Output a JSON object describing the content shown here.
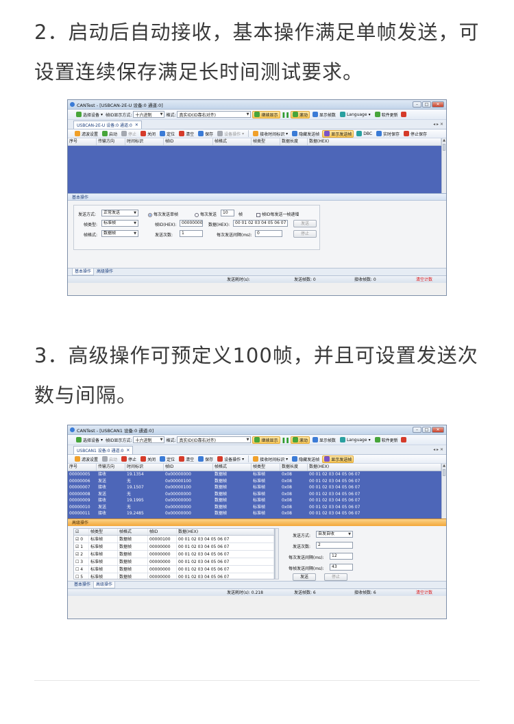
{
  "captions": {
    "cap1": "2．启动后自动接收，基本操作满足单帧发送，可设置连续保存满足长时间测试要求。",
    "cap2": "3．高级操作可预定义100帧，并且可设置发送次数与间隔。"
  },
  "win1": {
    "title": "CANTest - [USBCAN-2E-U 设备:0 通道:0]",
    "tab": "USBCAN-2E-U 设备:0 通道:0",
    "toolbar2": [
      "滤波设置",
      "启动",
      "停止",
      "关闭",
      "定位",
      "清空",
      "保存",
      "设备操作",
      "接收时间标识",
      "隐藏发送帧",
      "显示发送帧",
      "DBC",
      "实时保存",
      "停止保存"
    ],
    "panel_title": "基本操作",
    "form": {
      "send_mode_label": "发送方式:",
      "send_mode_value": "正常发送",
      "frame_type_label": "帧类型:",
      "frame_type_value": "标准帧",
      "frame_format_label": "帧格式:",
      "frame_format_value": "数据帧",
      "radio1": "每次发送单帧",
      "radio2": "每次发送",
      "radio2_value": "10",
      "radio2_unit": "帧",
      "check_label": "帧ID每发送一帧递增",
      "frame_id_label": "帧ID(HEX):",
      "frame_id_value": "00000000",
      "data_label": "数据(HEX):",
      "data_value": "00 01 02 03 04 05 06 07",
      "count_label": "发送次数:",
      "count_value": "1",
      "interval_label": "每次发送间隔(ms):",
      "interval_value": "0",
      "send_btn": "发送",
      "stop_btn": "停止"
    },
    "bottom_tabs": [
      "基本操作",
      "高级操作"
    ],
    "status": {
      "time": "发送耗时(s):",
      "sent": "发送帧数: 0",
      "recv": "接收帧数: 0",
      "clear": "清空计数"
    }
  },
  "win2": {
    "title": "CANTest - [USBCAN1 设备:0 通道:0]",
    "tab": "USBCAN1 设备:0 通道:0",
    "toolbar2": [
      "滤波设置",
      "启动",
      "停止",
      "关闭",
      "定位",
      "清空",
      "保存",
      "设备操作",
      "接收时间标识",
      "隐藏发送帧",
      "显示发送帧"
    ],
    "rows": [
      [
        "00000005",
        "接收",
        "19.1354",
        "0x00000000",
        "数据帧",
        "标准帧",
        "0x08",
        "00 01 02 03 04 05 06 07"
      ],
      [
        "00000006",
        "发送",
        "无",
        "0x00000100",
        "数据帧",
        "标准帧",
        "0x08",
        "00 01 02 03 04 05 06 07"
      ],
      [
        "00000007",
        "接收",
        "19.1507",
        "0x00000100",
        "数据帧",
        "标准帧",
        "0x08",
        "00 01 02 03 04 05 06 07"
      ],
      [
        "00000008",
        "发送",
        "无",
        "0x00000000",
        "数据帧",
        "标准帧",
        "0x08",
        "00 01 02 03 04 05 06 07"
      ],
      [
        "00000009",
        "接收",
        "19.1995",
        "0x00000000",
        "数据帧",
        "标准帧",
        "0x08",
        "00 01 02 03 04 05 06 07"
      ],
      [
        "00000010",
        "发送",
        "无",
        "0x00000000",
        "数据帧",
        "标准帧",
        "0x08",
        "00 01 02 03 04 05 06 07"
      ],
      [
        "00000011",
        "接收",
        "19.2485",
        "0x00000000",
        "数据帧",
        "标准帧",
        "0x08",
        "00 01 02 03 04 05 06 07"
      ]
    ],
    "panel_title": "高级操作",
    "adv_headers": [
      "☑",
      "帧类型",
      "帧格式",
      "帧ID",
      "数据(HEX)"
    ],
    "adv_rows": [
      [
        "☑ 0",
        "标准帧",
        "数据帧",
        "00000100",
        "00 01 02 03 04 05 06 07"
      ],
      [
        "☑ 1",
        "标准帧",
        "数据帧",
        "00000000",
        "00 01 02 03 04 05 06 07"
      ],
      [
        "☑ 2",
        "标准帧",
        "数据帧",
        "00000000",
        "00 01 02 03 04 05 06 07"
      ],
      [
        "☐ 3",
        "标准帧",
        "数据帧",
        "00000000",
        "00 01 02 03 04 05 06 07"
      ],
      [
        "☐ 4",
        "标准帧",
        "数据帧",
        "00000000",
        "00 01 02 03 04 05 06 07"
      ],
      [
        "☐ 5",
        "标准帧",
        "数据帧",
        "00000000",
        "00 01 02 03 04 05 06 07"
      ]
    ],
    "adv_form": {
      "send_mode_label": "发送方式:",
      "send_mode_value": "自发自收",
      "count_label": "发送次数:",
      "count_value": "2",
      "interval_label": "每次发送间隔(ms):",
      "interval_value": "12",
      "frame_interval_label": "每帧发送间隔(ms):",
      "frame_interval_value": "43",
      "send_btn": "发送",
      "stop_btn": "停止"
    },
    "bottom_tabs": [
      "基本操作",
      "高级操作"
    ],
    "status": {
      "time": "发送耗时(s): 0.218",
      "sent": "发送帧数: 6",
      "recv": "接收帧数: 6",
      "clear": "清空计数"
    }
  },
  "common": {
    "toolbar1": {
      "device": "选择设备",
      "id_mode_label": "帧ID显示方式:",
      "id_mode_value": "十六进制",
      "format_label": "格式:",
      "format_value": "真实ID(ID靠右对齐)",
      "continue": "继续显示",
      "scroll": "滚动",
      "show_frames": "显示帧数",
      "language": "Language",
      "update": "软件更新"
    },
    "grid_headers": [
      "序号",
      "传输方向",
      "时间标识",
      "帧ID",
      "帧格式",
      "帧类型",
      "数据长度",
      "数据(HEX)"
    ]
  }
}
